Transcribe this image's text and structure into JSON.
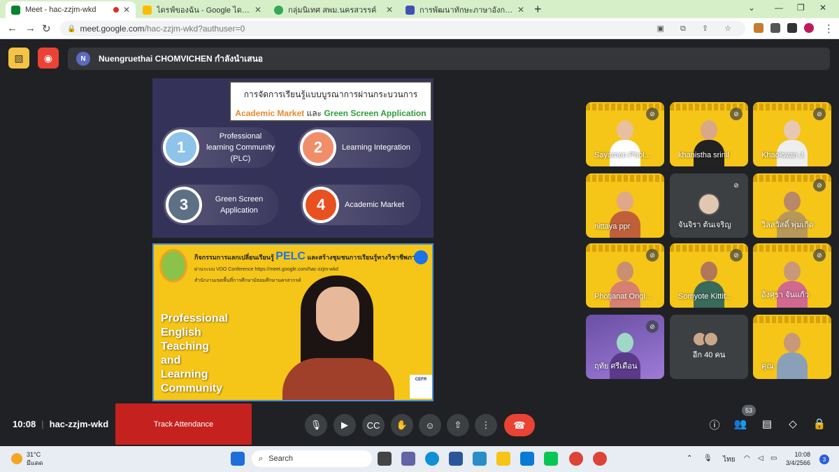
{
  "browser": {
    "tabs": [
      {
        "title": "Meet - hac-zzjm-wkd",
        "color": "#1a73e8"
      },
      {
        "title": "ไดรฟ์ของฉัน - Google ไดรฟ์",
        "color": "#fbbc04"
      },
      {
        "title": "กลุ่มนิเทศ สพม.นครสวรรค์",
        "color": "#34a853"
      },
      {
        "title": "การพัฒนาทักษะภาษาอังกฤษ English",
        "color": "#3f51b5"
      }
    ],
    "url_host": "meet.google.com",
    "url_path": "/hac-zzjm-wkd?authuser=0"
  },
  "meet": {
    "presenter_initial": "N",
    "presenter_text": "Nuengruethai CHOMVICHEN กำลังนำเสนอ",
    "slide1": {
      "title_line1": "การจัดการเรียนรู้แบบบูรณาการผ่านกระบวนการ",
      "title_part_a": "Academic Market",
      "title_part_mid": " และ ",
      "title_part_b": "Green Screen Application",
      "items": [
        {
          "num": "1",
          "label": "Professional learning Community (PLC)"
        },
        {
          "num": "2",
          "label": "Learning Integration"
        },
        {
          "num": "3",
          "label": "Green Screen Application"
        },
        {
          "num": "4",
          "label": "Academic Market"
        }
      ]
    },
    "slide2": {
      "head": "กิจกรรมการแลกเปลี่ยนเรียนรู้",
      "pelc": "PELC",
      "head2": "และสร้างชุมชนการเรียนรู้ทางวิชาชีพภาษา",
      "sub": "ผ่านระบบ VDO Conference https://meet.google.com/hac-zzjm-wkd",
      "sub2": "สำนักงานเขตพื้นที่การศึกษามัธยมศึกษานครสวรรค์",
      "big_title": [
        "Professional",
        "English",
        "Teaching",
        "and",
        "Learning",
        "Community"
      ],
      "badge": "CEFR"
    },
    "participants": [
      {
        "name": "Sayamon Phol...",
        "type": "video"
      },
      {
        "name": "khanistha srinil",
        "type": "video"
      },
      {
        "name": "Khaokwan J.",
        "type": "video"
      },
      {
        "name": "nittaya ppr",
        "type": "video"
      },
      {
        "name": "จันจิรา ต้นเจริญ",
        "type": "avatar"
      },
      {
        "name": "วิลสวัสดิ์ พุ่มเกิด",
        "type": "video"
      },
      {
        "name": "Photjanat Ongl...",
        "type": "video"
      },
      {
        "name": "Somyote Kittit...",
        "type": "video"
      },
      {
        "name": "อังศุรา จันแก้ว",
        "type": "video"
      },
      {
        "name": "ฤทัย ศรีเดือน",
        "type": "video"
      },
      {
        "name": "อีก 40 คน",
        "type": "more"
      },
      {
        "name": "คุณ",
        "type": "self"
      }
    ],
    "time": "10:08",
    "meeting_code": "hac-zzjm-wkd",
    "track_attendance": "Track Attendance",
    "participant_count": "53"
  },
  "taskbar": {
    "temperature": "31°C",
    "weather": "มีแดด",
    "search_placeholder": "Search",
    "lang": "ไทย",
    "clock_time": "10:08",
    "clock_date": "3/4/2566",
    "notifications": "3"
  }
}
